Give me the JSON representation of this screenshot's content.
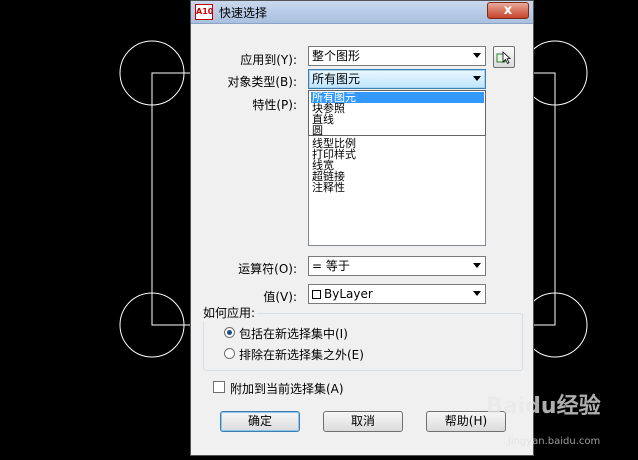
{
  "dialog": {
    "title": "快速选择",
    "close_label": "x",
    "app_icon_text": "A10"
  },
  "fields": {
    "apply_to_label": "应用到(Y):",
    "apply_to_value": "整个图形",
    "object_type_label": "对象类型(B):",
    "object_type_value": "所有图元",
    "properties_label": "特性(P):",
    "operator_label": "运算符(O):",
    "operator_value": "= 等于",
    "value_label": "值(V):",
    "value_value": "ByLayer"
  },
  "object_type_options": [
    "所有图元",
    "块参照",
    "直线",
    "圆"
  ],
  "properties_visible": [
    "线型比例",
    "打印样式",
    "线宽",
    "超链接",
    "注释性"
  ],
  "how_to_apply": {
    "title": "如何应用:",
    "include_label": "包括在新选择集中(I)",
    "exclude_label": "排除在新选择集之外(E)",
    "selected": "include"
  },
  "append_label": "附加到当前选择集(A)",
  "buttons": {
    "ok": "确定",
    "cancel": "取消",
    "help": "帮助(H)"
  },
  "watermark": {
    "text": "Baidu经验",
    "sub": "jingyan.baidu.com"
  },
  "colors": {
    "canvas_bg": "#000000",
    "dialog_bg": "#f0f0f0",
    "highlight": "#3399ff"
  }
}
